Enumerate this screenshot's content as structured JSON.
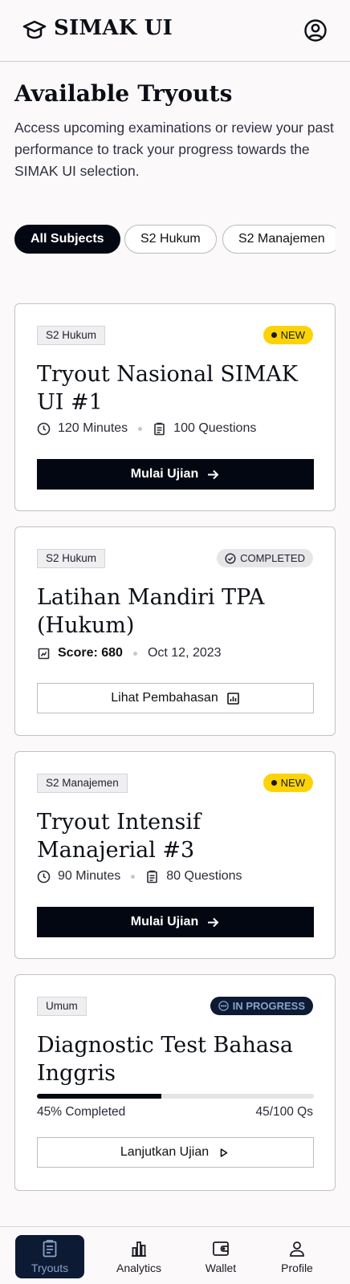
{
  "header": {
    "title": "SIMAK UI",
    "logo_icon": "graduation-cap-icon",
    "account_icon": "account-circle-icon"
  },
  "intro": {
    "title": "Available Tryouts",
    "description": "Access upcoming examinations or review your past performance to track your progress towards the SIMAK UI selection."
  },
  "filters": [
    "All Subjects",
    "S2 Hukum",
    "S2 Manajemen"
  ],
  "cards": [
    {
      "tag": "S2 Hukum",
      "badge": "NEW",
      "title": "Tryout Nasional SIMAK UI #1",
      "duration": "120 Minutes",
      "questions": "100 Questions",
      "button": "Mulai Ujian"
    },
    {
      "tag": "S2 Hukum",
      "badge": "COMPLETED",
      "title": "Latihan Mandiri TPA (Hukum)",
      "score": "Score: 680",
      "date": "Oct 12, 2023",
      "button": "Lihat Pembahasan"
    },
    {
      "tag": "S2 Manajemen",
      "badge": "NEW",
      "title": "Tryout Intensif Manajerial #3",
      "duration": "90 Minutes",
      "questions": "80 Questions",
      "button": "Mulai Ujian"
    },
    {
      "tag": "Umum",
      "badge": "IN PROGRESS",
      "title": "Diagnostic Test Bahasa Inggris",
      "progress": 0.45,
      "progress_label": "45% Completed",
      "progress_count": "45/100 Qs",
      "button": "Lanjutkan Ujian"
    }
  ],
  "nav": [
    "Tryouts",
    "Analytics",
    "Wallet",
    "Profile"
  ],
  "colors": {
    "primary": "#030712",
    "accent_new": "#fcd306",
    "nav_active": "#0c1a33"
  }
}
